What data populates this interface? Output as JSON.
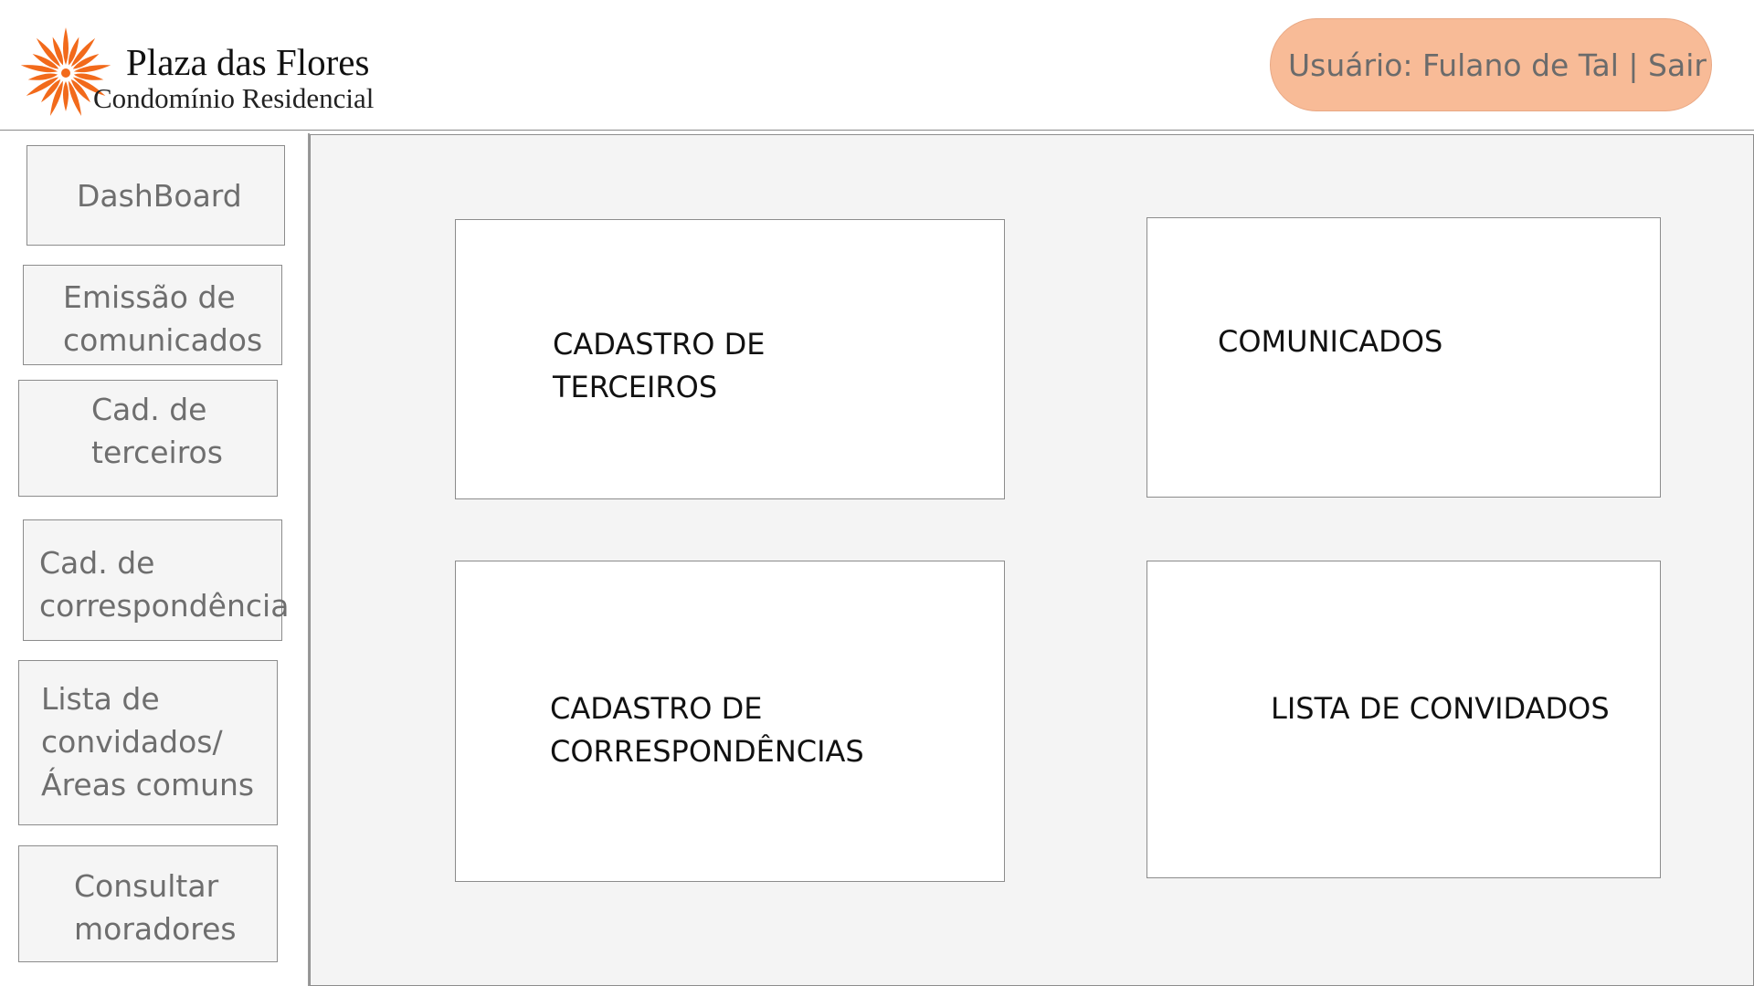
{
  "header": {
    "logo_title": "Plaza das Flores",
    "logo_subtitle": "Condomínio Residencial",
    "logo_icon": "orange-flower-icon",
    "user_label": "Usuário: Fulano de Tal | Sair"
  },
  "sidebar": {
    "items": [
      {
        "label": "DashBoard"
      },
      {
        "label": "Emissão de\ncomunicados"
      },
      {
        "label": "Cad. de\nterceiros"
      },
      {
        "label": "Cad. de\ncorrespondência"
      },
      {
        "label": "Lista de\nconvidados/\nÁreas comuns"
      },
      {
        "label": "Consultar\nmoradores"
      }
    ]
  },
  "main": {
    "cards": [
      {
        "label": "CADASTRO DE\nTERCEIROS"
      },
      {
        "label": "COMUNICADOS"
      },
      {
        "label": "CADASTRO DE\nCORRESPONDÊNCIAS"
      },
      {
        "label": "LISTA DE CONVIDADOS"
      }
    ]
  },
  "colors": {
    "brand_orange": "#f26a1b",
    "user_pill": "#f8bb97",
    "panel_background": "#f4f4f4",
    "border": "#8c8c8c"
  }
}
